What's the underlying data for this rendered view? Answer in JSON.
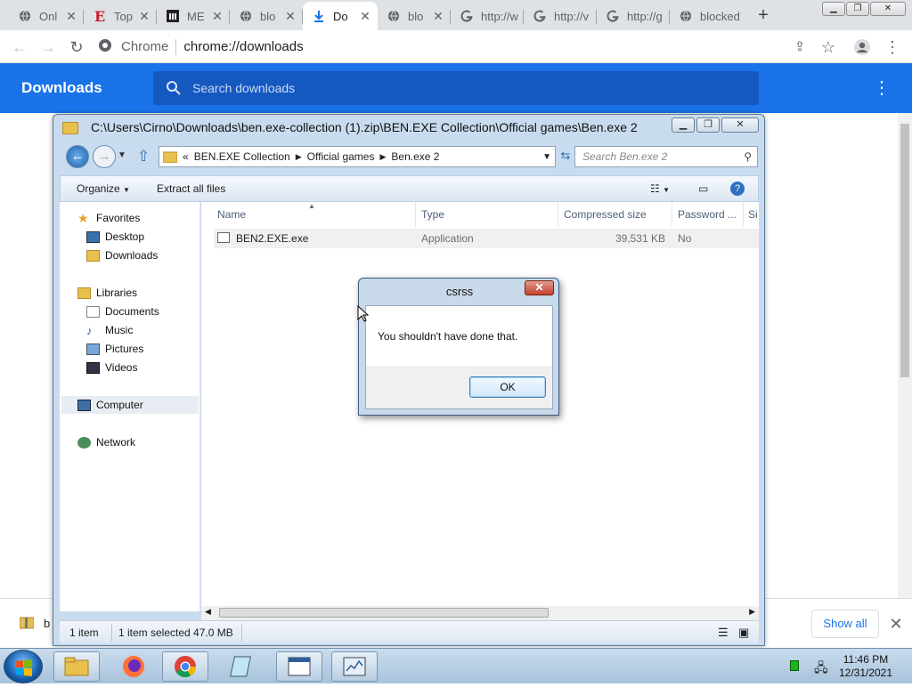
{
  "chrome": {
    "tabs": [
      {
        "title": "Onl",
        "icon": "globe-icon"
      },
      {
        "title": "Top",
        "icon": "e-logo-icon"
      },
      {
        "title": "ME",
        "icon": "museum-icon"
      },
      {
        "title": "blo",
        "icon": "globe-icon"
      },
      {
        "title": "Do",
        "icon": "download-icon",
        "active": true
      },
      {
        "title": "blo",
        "icon": "globe-icon"
      },
      {
        "title": "http://w",
        "icon": "google-icon"
      },
      {
        "title": "http://v",
        "icon": "google-icon"
      },
      {
        "title": "http://g",
        "icon": "google-icon"
      },
      {
        "title": "blocked",
        "icon": "globe-icon"
      }
    ],
    "site_label": "Chrome",
    "url": "chrome://downloads"
  },
  "downloads_page": {
    "title": "Downloads",
    "search_placeholder": "Search downloads",
    "shelf_item_name": "b",
    "show_all_label": "Show all"
  },
  "explorer": {
    "title": "C:\\Users\\Cirno\\Downloads\\ben.exe-collection (1).zip\\BEN.EXE Collection\\Official games\\Ben.exe 2",
    "breadcrumb": [
      "BEN.EXE Collection",
      "Official games",
      "Ben.exe 2"
    ],
    "breadcrumb_prefix": "«",
    "search_placeholder": "Search Ben.exe 2",
    "commands": {
      "organize": "Organize",
      "extract": "Extract all files"
    },
    "nav": {
      "favorites": "Favorites",
      "desktop": "Desktop",
      "downloads": "Downloads",
      "libraries": "Libraries",
      "documents": "Documents",
      "music": "Music",
      "pictures": "Pictures",
      "videos": "Videos",
      "computer": "Computer",
      "network": "Network"
    },
    "columns": {
      "name": "Name",
      "type": "Type",
      "size": "Compressed size",
      "password": "Password ...",
      "extra": "Si"
    },
    "file": {
      "name": "BEN2.EXE.exe",
      "type": "Application",
      "size": "39,531 KB",
      "password": "No"
    },
    "status": {
      "count": "1 item",
      "selected": "1 item selected  47.0 MB"
    }
  },
  "dialog": {
    "title": "csrss",
    "message": "You shouldn't have done that.",
    "ok_label": "OK",
    "close_glyph": "✕"
  },
  "taskbar": {
    "time": "11:46 PM",
    "date": "12/31/2021"
  },
  "colors": {
    "chrome_accent": "#1a73e8",
    "explorer_frame": "#c9dbee",
    "taskbar": "#b9cfe4"
  }
}
